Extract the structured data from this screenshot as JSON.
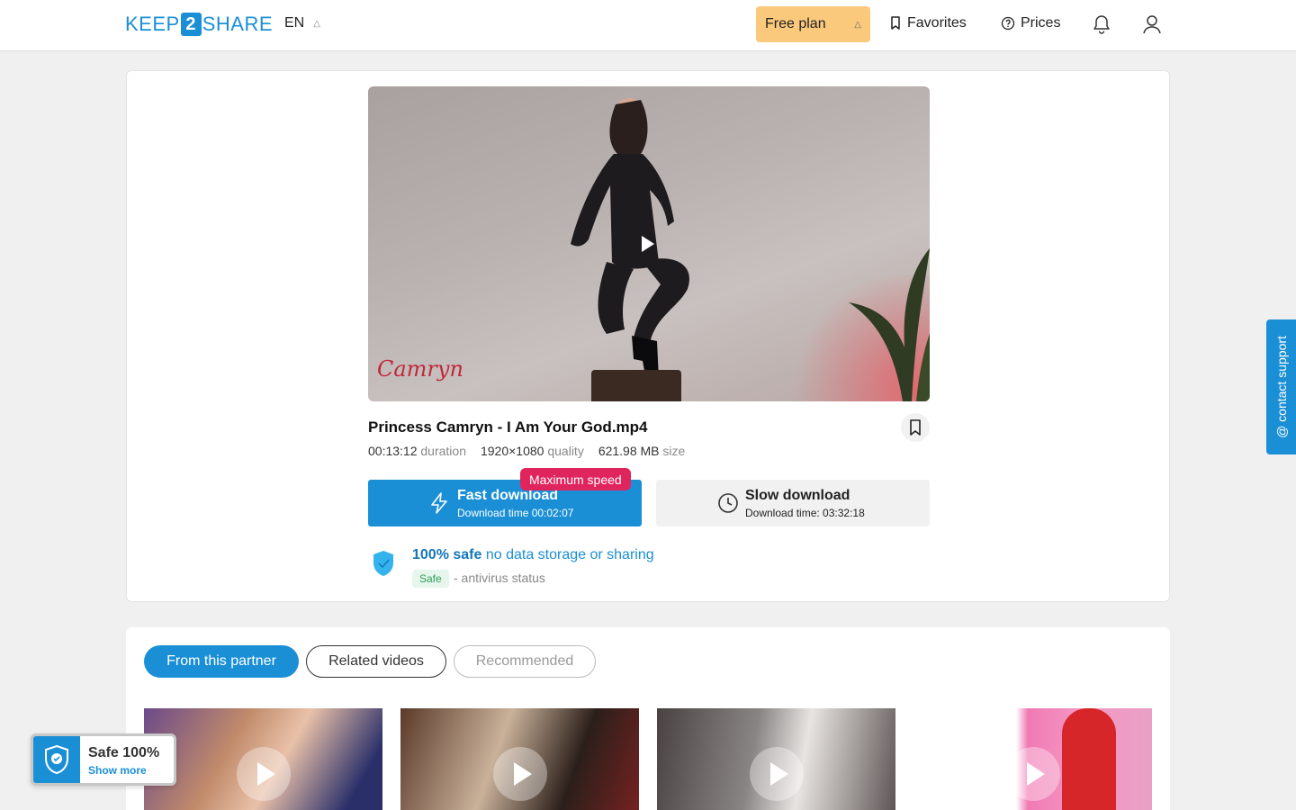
{
  "header": {
    "logo_left": "KEEP",
    "logo_mid": "2",
    "logo_right": "SHARE",
    "language": "EN",
    "plan_label": "Free plan",
    "favorites_label": "Favorites",
    "prices_label": "Prices"
  },
  "video": {
    "watermark": "Camryn"
  },
  "file": {
    "title": "Princess Camryn - I Am Your God.mp4",
    "duration_value": "00:13:12",
    "duration_label": "duration",
    "quality_value": "1920×1080",
    "quality_label": "quality",
    "size_value": "621.98 MB",
    "size_label": "size"
  },
  "downloads": {
    "badge": "Maximum speed",
    "fast_title": "Fast download",
    "fast_time": "Download time 00:02:07",
    "slow_title": "Slow download",
    "slow_time": "Download time: 03:32:18"
  },
  "safety": {
    "safe_bold": "100% safe",
    "safe_text": "no data storage or sharing",
    "badge": "Safe",
    "status": "- antivirus status"
  },
  "tabs": [
    {
      "label": "From this partner",
      "active": true
    },
    {
      "label": "Related videos",
      "active": false
    },
    {
      "label": "Recommended",
      "active": false
    }
  ],
  "widget": {
    "title": "Safe 100%",
    "link": "Show more"
  },
  "support": {
    "label": "@ contact support"
  },
  "colors": {
    "accent": "#1a8fd6",
    "plan_bg": "#fbc97c",
    "badge_red": "#e0245e",
    "safe_green": "#2e9e57"
  },
  "icons": [
    "bookmark-icon",
    "help-circle-icon",
    "bell-icon",
    "user-icon",
    "lightning-icon",
    "clock-icon",
    "shield-check-icon",
    "play-icon",
    "chevron-up-icon"
  ]
}
